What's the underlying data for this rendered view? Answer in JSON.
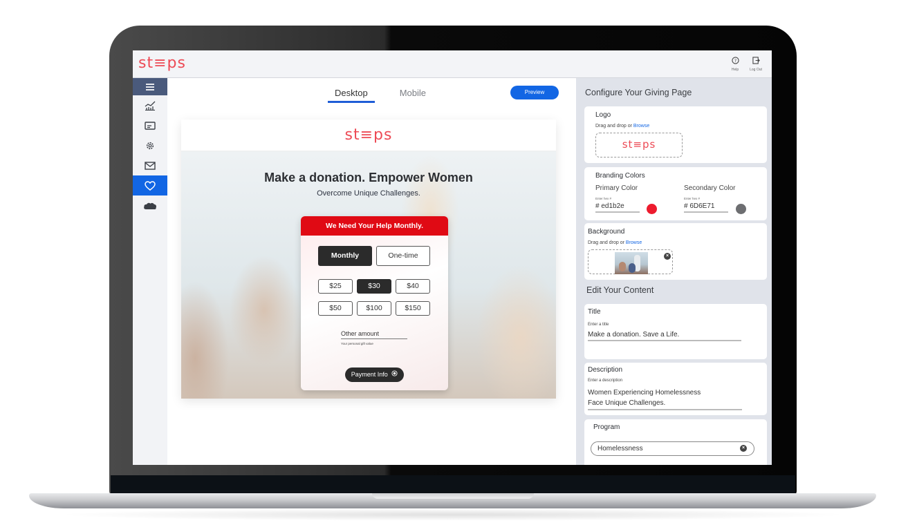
{
  "app": {
    "brand": "st≡ps",
    "brand_color": "#ed4a55",
    "accent_color": "#1266e4",
    "top_actions": [
      {
        "icon": "help-icon",
        "glyph": "?",
        "label": "Help"
      },
      {
        "icon": "logout-icon",
        "glyph": "⇥",
        "label": "Log Out"
      }
    ]
  },
  "sidebar": {
    "items": [
      {
        "name": "menu",
        "icon": "hamburger-icon",
        "active": false
      },
      {
        "name": "analytics",
        "icon": "chart-icon",
        "active": false
      },
      {
        "name": "payments",
        "icon": "card-icon",
        "active": false
      },
      {
        "name": "settings",
        "icon": "gear-icon",
        "active": false
      },
      {
        "name": "email",
        "icon": "mail-icon",
        "active": false
      },
      {
        "name": "giving-page",
        "icon": "heart-icon",
        "active": true
      },
      {
        "name": "salesforce",
        "icon": "cloud-icon",
        "active": false
      }
    ]
  },
  "main": {
    "tabs": [
      {
        "label": "Desktop",
        "active": true
      },
      {
        "label": "Mobile",
        "active": false
      }
    ],
    "preview_label": "Preview",
    "page": {
      "logo": "st≡ps",
      "title": "Make a donation. Empower Women",
      "subtitle": "Overcome Unique Challenges.",
      "card": {
        "header": "We Need Your Help Monthly.",
        "header_color": "#e00a14",
        "frequencies": [
          {
            "label": "Monthly",
            "selected": true
          },
          {
            "label": "One-time",
            "selected": false
          }
        ],
        "amounts": [
          {
            "label": "$25",
            "selected": false
          },
          {
            "label": "$30",
            "selected": true
          },
          {
            "label": "$40",
            "selected": false
          },
          {
            "label": "$50",
            "selected": false
          },
          {
            "label": "$100",
            "selected": false
          },
          {
            "label": "$150",
            "selected": false
          }
        ],
        "other_amount_placeholder": "Other amount",
        "other_amount_help": "Your personal gift value",
        "payment_button": "Payment Info"
      }
    }
  },
  "config": {
    "heading": "Configure Your Giving Page",
    "logo": {
      "title": "Logo",
      "hint_prefix": "Drag and drop or ",
      "browse": "Browse",
      "preview": "st≡ps"
    },
    "branding": {
      "title": "Branding Colors",
      "primary_label": "Primary Color",
      "secondary_label": "Secondary Color",
      "hex_hint": "Enter hex #",
      "primary_value": "# ed1b2e",
      "secondary_value": "# 6D6E71",
      "primary_color": "#ed1b2e",
      "secondary_color": "#6D6E71"
    },
    "background": {
      "title": "Background",
      "hint_prefix": "Drag and drop or ",
      "browse": "Browse"
    },
    "content_heading": "Edit Your Content",
    "title_field": {
      "title": "Title",
      "hint": "Enter a title",
      "value": "Make a donation. Save a Life."
    },
    "description_field": {
      "title": "Description",
      "hint": "Enter a description",
      "value_line1": "Women Experiencing Homelessness",
      "value_line2": "Face Unique Challenges."
    },
    "program": {
      "title": "Program",
      "value": "Homelessness"
    }
  }
}
